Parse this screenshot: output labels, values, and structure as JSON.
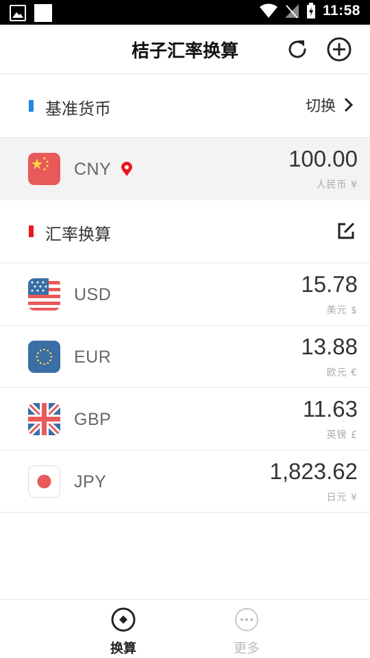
{
  "status_bar": {
    "time": "11:58"
  },
  "header": {
    "title": "桔子汇率换算"
  },
  "base_section": {
    "title": "基准货币",
    "switch_label": "切换",
    "accent": "#1e88e5"
  },
  "base_currency": {
    "code": "CNY",
    "amount": "100.00",
    "unit": "人民币 ¥"
  },
  "convert_section": {
    "title": "汇率换算",
    "accent": "#e8191e"
  },
  "currencies": [
    {
      "code": "USD",
      "amount": "15.78",
      "unit": "美元 $"
    },
    {
      "code": "EUR",
      "amount": "13.88",
      "unit": "欧元 €"
    },
    {
      "code": "GBP",
      "amount": "11.63",
      "unit": "英镑 £"
    },
    {
      "code": "JPY",
      "amount": "1,823.62",
      "unit": "日元 ¥"
    }
  ],
  "bottom_nav": {
    "convert_label": "换算",
    "more_label": "更多"
  },
  "icons": {
    "refresh": "refresh-icon",
    "add": "add-circle-icon",
    "chevron": "chevron-right-icon",
    "edit": "edit-icon",
    "location": "location-pin-icon"
  }
}
